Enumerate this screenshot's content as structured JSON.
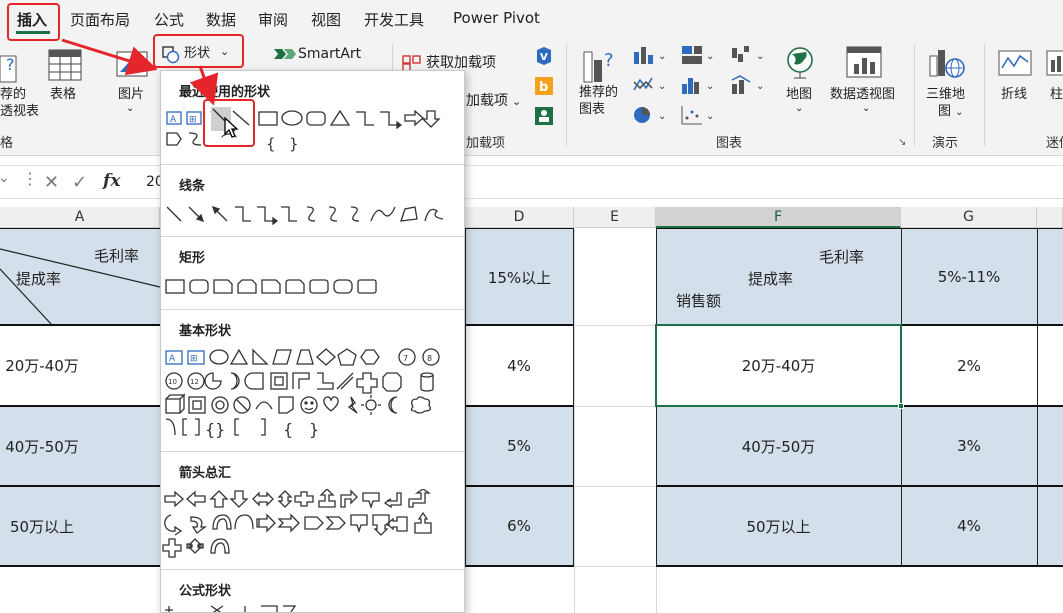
{
  "tabs": [
    "插入",
    "页面布局",
    "公式",
    "数据",
    "审阅",
    "视图",
    "开发工具",
    "Power Pivot"
  ],
  "active_tab": "插入",
  "ribbon": {
    "recommended_pivot": [
      "荐的",
      "透视表"
    ],
    "table": "表格",
    "pictures": "图片",
    "shapes_button": "形状",
    "smartart": "SmartArt",
    "get_addins": "获取加载项",
    "my_addins": "加载项",
    "recommended_charts": [
      "推荐的",
      "图表"
    ],
    "map": "地图",
    "pivot_chart": "数据透视图",
    "map3d": [
      "三维地",
      "图"
    ],
    "line_spark": "折线",
    "column_spark": "柱",
    "groups": {
      "tables": "格",
      "addins": "加载项",
      "charts": "图表",
      "tours": "演示",
      "sparklines": "迷你"
    }
  },
  "formula_bar": {
    "value": "20"
  },
  "column_headers": [
    "A",
    "D",
    "E",
    "F",
    "G"
  ],
  "sheet": {
    "diag_header": {
      "top_right": "毛利率",
      "middle": "提成率",
      "bottom_left": "销售额"
    },
    "left_diag": {
      "top_right": "毛利率",
      "middle": "提成率"
    },
    "d_header": "15%以上",
    "g_header": "5%-11%",
    "rows": [
      {
        "a": "20万-40万",
        "d": "4%",
        "f": "20万-40万",
        "g": "2%"
      },
      {
        "a": "40万-50万",
        "d": "5%",
        "f": "40万-50万",
        "g": "3%"
      },
      {
        "a": "50万以上",
        "d": "6%",
        "f": "50万以上",
        "g": "4%"
      }
    ]
  },
  "dropdown": {
    "sections": {
      "recent": "最近使用的形状",
      "lines": "线条",
      "rects": "矩形",
      "basic": "基本形状",
      "arrows": "箭头总汇",
      "equation": "公式形状"
    },
    "brace_glyphs": [
      "{",
      "}"
    ]
  },
  "colors": {
    "excel_green": "#1e7145",
    "highlight_red": "#e4262b",
    "cell_blue": "#d3dfea",
    "icon_blue": "#2e6bbf"
  }
}
